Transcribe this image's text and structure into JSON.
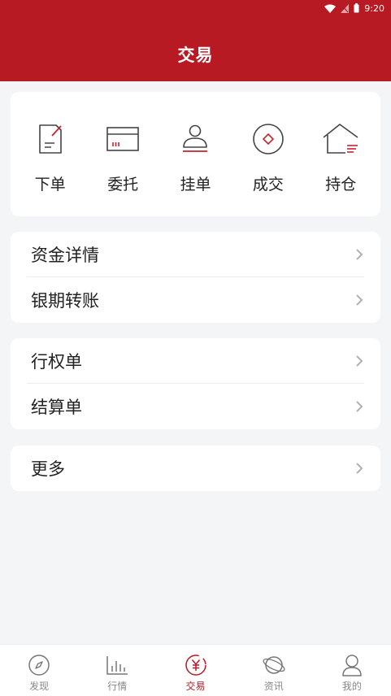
{
  "status_bar": {
    "time": "9:20"
  },
  "header": {
    "title": "交易"
  },
  "quick_actions": [
    {
      "label": "下单",
      "icon": "order-icon"
    },
    {
      "label": "委托",
      "icon": "entrust-icon"
    },
    {
      "label": "挂单",
      "icon": "pending-order-icon"
    },
    {
      "label": "成交",
      "icon": "deal-icon"
    },
    {
      "label": "持仓",
      "icon": "position-icon"
    }
  ],
  "groups": [
    {
      "items": [
        {
          "label": "资金详情"
        },
        {
          "label": "银期转账"
        }
      ]
    },
    {
      "items": [
        {
          "label": "行权单"
        },
        {
          "label": "结算单"
        }
      ]
    },
    {
      "items": [
        {
          "label": "更多"
        }
      ]
    }
  ],
  "tabbar": {
    "tabs": [
      {
        "label": "发现",
        "icon": "compass-icon"
      },
      {
        "label": "行情",
        "icon": "chart-icon"
      },
      {
        "label": "交易",
        "icon": "yuan-icon"
      },
      {
        "label": "资讯",
        "icon": "planet-icon"
      },
      {
        "label": "我的",
        "icon": "user-icon"
      }
    ],
    "active": "交易"
  },
  "colors": {
    "brand": "#b81a24",
    "background": "#f4f5f7",
    "text": "#222222",
    "muted": "#888888"
  }
}
